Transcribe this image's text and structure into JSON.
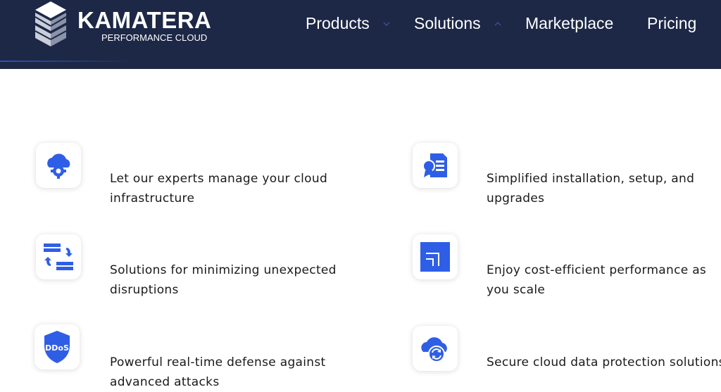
{
  "header": {
    "logo": {
      "title": "KAMATERA",
      "subtitle": "PERFORMANCE CLOUD"
    },
    "nav": {
      "products": "Products",
      "solutions": "Solutions",
      "marketplace": "Marketplace",
      "pricing": "Pricing"
    }
  },
  "features": [
    {
      "icon": "cloud-gear-icon",
      "text": "Let our experts manage your cloud infrastructure"
    },
    {
      "icon": "certificate-document-icon",
      "text": "Simplified installation, setup, and upgrades"
    },
    {
      "icon": "server-swap-icon",
      "text": "Solutions for minimizing unexpected disruptions"
    },
    {
      "icon": "scale-squares-icon",
      "text": "Enjoy cost-efficient performance as you scale"
    },
    {
      "icon": "ddos-shield-icon",
      "text": "Powerful real-time defense against advanced attacks",
      "badge": "DDoS"
    },
    {
      "icon": "cloud-sync-icon",
      "text": "Secure cloud data protection solutions"
    }
  ],
  "colors": {
    "header_bg": "#1d2847",
    "accent_blue": "#2f5ee6",
    "text": "#1a1a1a"
  }
}
